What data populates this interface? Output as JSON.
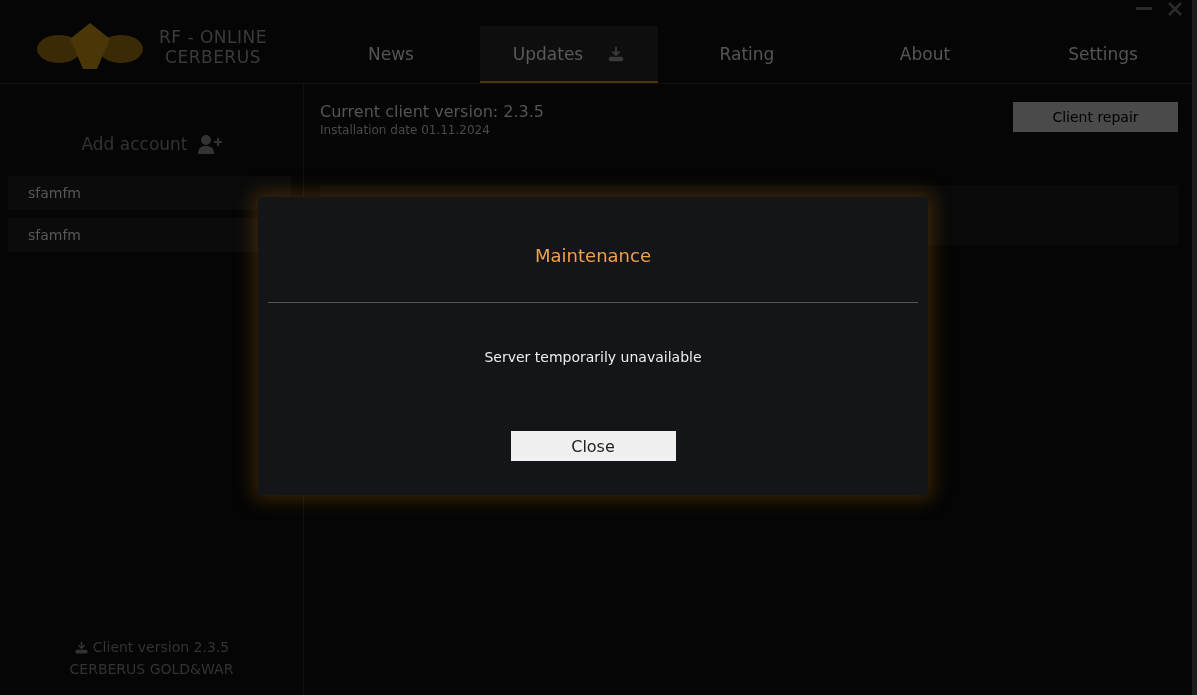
{
  "logo": {
    "line_1": "RF - ONLINE",
    "line_2": "CERBERUS"
  },
  "tabs": [
    {
      "label": "News",
      "selected": false,
      "kind": "text"
    },
    {
      "label": "Updates",
      "selected": true,
      "kind": "download"
    },
    {
      "label": "Rating",
      "selected": false,
      "kind": "text"
    },
    {
      "label": "About",
      "selected": false,
      "kind": "text"
    },
    {
      "label": "Settings",
      "selected": false,
      "kind": "text"
    }
  ],
  "sidebar": {
    "add_account": "Add account",
    "accounts": [
      "sfamfm",
      "sfamfm"
    ],
    "client_version": "Client version 2.3.5",
    "footer": "CERBERUS GOLD&WAR"
  },
  "updates": {
    "current_version": "Current client version: 2.3.5",
    "install_date": "Installation date 01.11.2024",
    "repair_button": "Client repair"
  },
  "dialog": {
    "title": "Maintenance",
    "message": "Server temporarily unavailable",
    "button": "Close"
  }
}
